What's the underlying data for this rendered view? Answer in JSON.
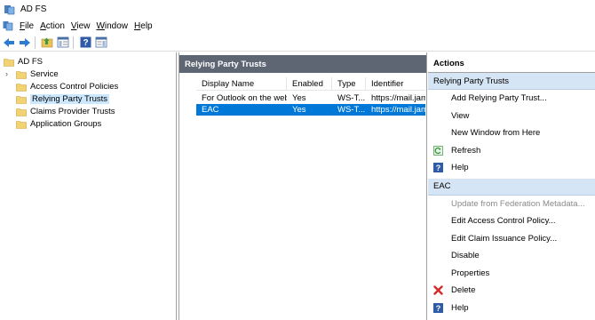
{
  "window": {
    "title": "AD FS"
  },
  "menu": [
    {
      "label_u": "F",
      "label_rest": "ile"
    },
    {
      "label_u": "A",
      "label_rest": "ction"
    },
    {
      "label_u": "V",
      "label_rest": "iew"
    },
    {
      "label_u": "W",
      "label_rest": "indow"
    },
    {
      "label_u": "H",
      "label_rest": "elp"
    }
  ],
  "tree": {
    "root": "AD FS",
    "items": [
      {
        "label": "Service",
        "expandable": true
      },
      {
        "label": "Access Control Policies"
      },
      {
        "label": "Relying Party Trusts",
        "selected": true
      },
      {
        "label": "Claims Provider Trusts"
      },
      {
        "label": "Application Groups"
      }
    ]
  },
  "middle": {
    "header": "Relying Party Trusts",
    "columns": [
      "Display Name",
      "Enabled",
      "Type",
      "Identifier"
    ],
    "rows": [
      [
        "For Outlook on the web",
        "Yes",
        "WS-T...",
        "https://mail.jame"
      ],
      [
        "EAC",
        "Yes",
        "WS-T...",
        "https://mail.jame"
      ]
    ],
    "selected_row": 1
  },
  "actions": {
    "title": "Actions",
    "section1": {
      "label": "Relying Party Trusts",
      "items": [
        {
          "label": "Add Relying Party Trust...",
          "icon": ""
        },
        {
          "label": "View",
          "icon": ""
        },
        {
          "label": "New Window from Here",
          "icon": ""
        },
        {
          "label": "Refresh",
          "icon": "refresh-icon"
        },
        {
          "label": "Help",
          "icon": "help-icon"
        }
      ]
    },
    "section2": {
      "label": "EAC",
      "items": [
        {
          "label": "Update from Federation Metadata...",
          "icon": "",
          "disabled": true
        },
        {
          "label": "Edit Access Control Policy...",
          "icon": ""
        },
        {
          "label": "Edit Claim Issuance Policy...",
          "icon": ""
        },
        {
          "label": "Disable",
          "icon": ""
        },
        {
          "label": "Properties",
          "icon": ""
        },
        {
          "label": "Delete",
          "icon": "delete-icon"
        },
        {
          "label": "Help",
          "icon": "help-icon"
        }
      ]
    }
  },
  "colors": {
    "selection_blue": "#0078d7",
    "tree_selection": "#cce8ff",
    "pane_header": "#5f6673",
    "actions_section": "#d6e5f5"
  }
}
